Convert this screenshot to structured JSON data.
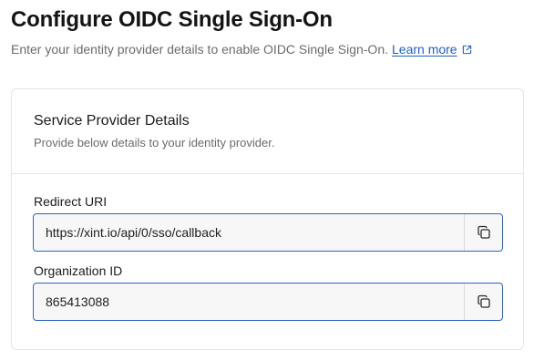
{
  "header": {
    "title": "Configure OIDC Single Sign-On",
    "subtitle": "Enter your identity provider details to enable OIDC Single Sign-On.",
    "learn_more": "Learn more"
  },
  "card": {
    "title": "Service Provider Details",
    "description": "Provide below details to your identity provider.",
    "fields": [
      {
        "label": "Redirect URI",
        "value": "https://xint.io/api/0/sso/callback",
        "action_icon": "copy-icon"
      },
      {
        "label": "Organization ID",
        "value": "865413088",
        "action_icon": "copy-icon"
      }
    ]
  },
  "colors": {
    "link": "#1d5fc9",
    "field_border": "#2f63c6",
    "field_bg": "#f7f7f7"
  }
}
